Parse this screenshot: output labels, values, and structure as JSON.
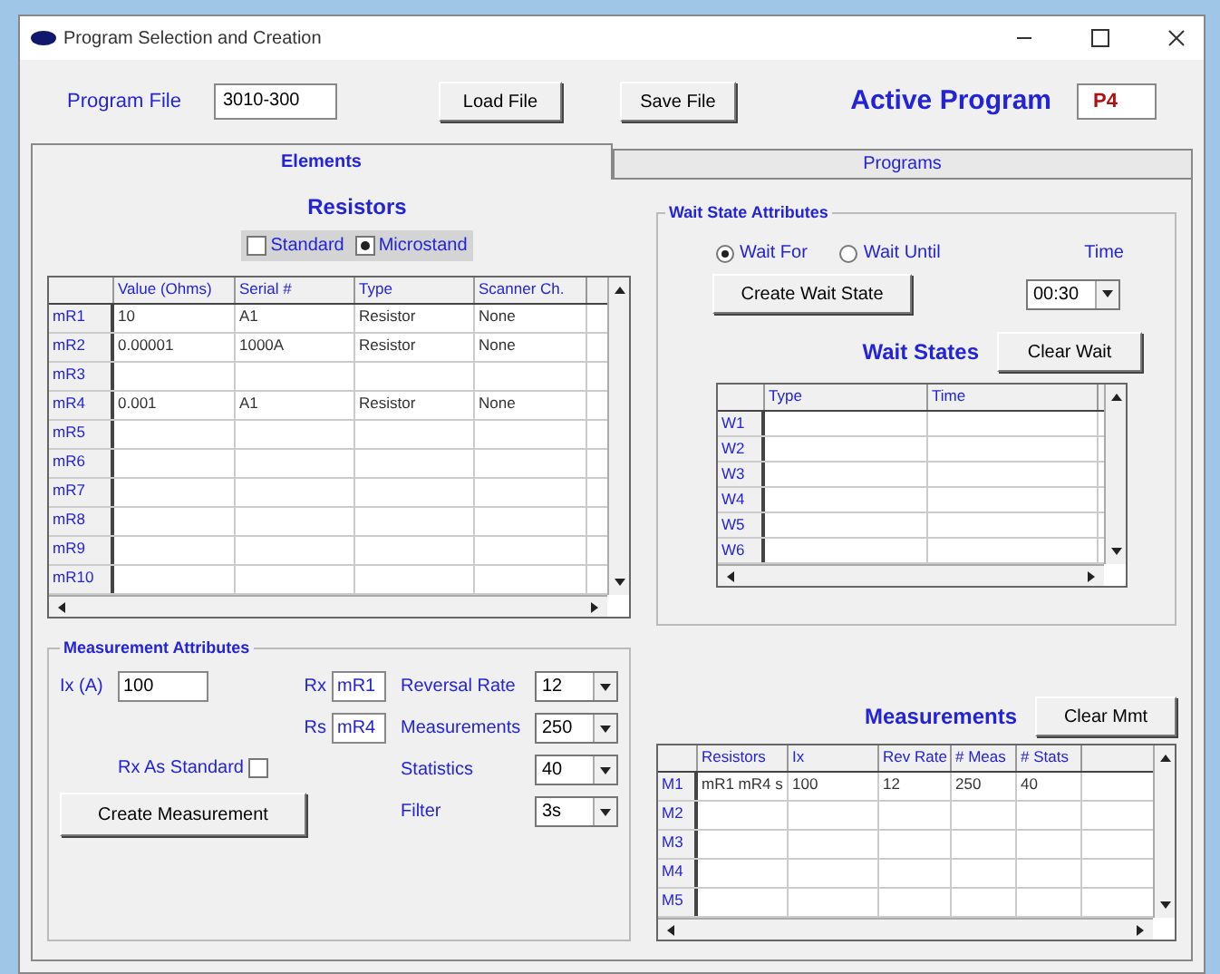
{
  "window": {
    "title": "Program Selection and Creation"
  },
  "toolbar": {
    "program_file_label": "Program File",
    "program_file": "3010-300",
    "buttons": [
      "Load File",
      "Save File"
    ],
    "active_program_label": "Active Program",
    "active_program": "P4"
  },
  "tabs": [
    {
      "label": "Elements",
      "selected": true
    },
    {
      "label": "Programs",
      "selected": false
    }
  ],
  "resistors": {
    "title": "Resistors",
    "options": [
      {
        "label": "Standard",
        "checked": false
      },
      {
        "label": "Microstand",
        "checked": true
      }
    ],
    "columns": [
      "Value (Ohms)",
      "Serial #",
      "Type",
      "Scanner Ch."
    ],
    "rows": [
      {
        "label": "mR1",
        "cells": [
          "10",
          "A1",
          "Resistor",
          "None"
        ]
      },
      {
        "label": "mR2",
        "cells": [
          "0.00001",
          "1000A",
          "Resistor",
          "None"
        ]
      },
      {
        "label": "mR3",
        "cells": []
      },
      {
        "label": "mR4",
        "cells": [
          "0.001",
          "A1",
          "Resistor",
          "None"
        ]
      },
      {
        "label": "mR5",
        "cells": []
      },
      {
        "label": "mR6",
        "cells": []
      },
      {
        "label": "mR7",
        "cells": []
      },
      {
        "label": "mR8",
        "cells": []
      },
      {
        "label": "mR9",
        "cells": []
      },
      {
        "label": "mR10",
        "cells": []
      }
    ]
  },
  "wait_state": {
    "title": "Wait State Attributes",
    "options": [
      {
        "label": "Wait For",
        "selected": true
      },
      {
        "label": "Wait Until",
        "selected": false
      }
    ],
    "time_label": "Time",
    "time": "00:30",
    "create_button": "Create Wait State",
    "list_title": "Wait States",
    "clear_button": "Clear Wait",
    "columns": [
      "Type",
      "Time"
    ],
    "rows": [
      {
        "label": "W1"
      },
      {
        "label": "W2"
      },
      {
        "label": "W3"
      },
      {
        "label": "W4"
      },
      {
        "label": "W5"
      },
      {
        "label": "W6"
      }
    ]
  },
  "measurement_attributes": {
    "title": "Measurement Attributes",
    "current_label": "Ix (A)",
    "current": "100",
    "rx_label": "Rx",
    "rx": "mR1",
    "rs_label": "Rs",
    "rs": "mR4",
    "standard_label": "Rx As Standard",
    "standard_checked": false,
    "selects": [
      {
        "label": "Reversal Rate",
        "value": "12"
      },
      {
        "label": "Measurements",
        "value": "250"
      },
      {
        "label": "Statistics",
        "value": "40"
      },
      {
        "label": "Filter",
        "value": "3s"
      }
    ],
    "create_button": "Create Measurement"
  },
  "measurements": {
    "title": "Measurements",
    "clear_button": "Clear Mmt",
    "columns": [
      "Resistors",
      "Ix",
      "Rev Rate",
      "# Meas",
      "# Stats"
    ],
    "rows": [
      {
        "label": "M1",
        "cells": [
          "mR1 mR4 s",
          "100",
          "12",
          "250",
          "40"
        ]
      },
      {
        "label": "M2",
        "cells": []
      },
      {
        "label": "M3",
        "cells": []
      },
      {
        "label": "M4",
        "cells": []
      },
      {
        "label": "M5",
        "cells": []
      }
    ]
  }
}
